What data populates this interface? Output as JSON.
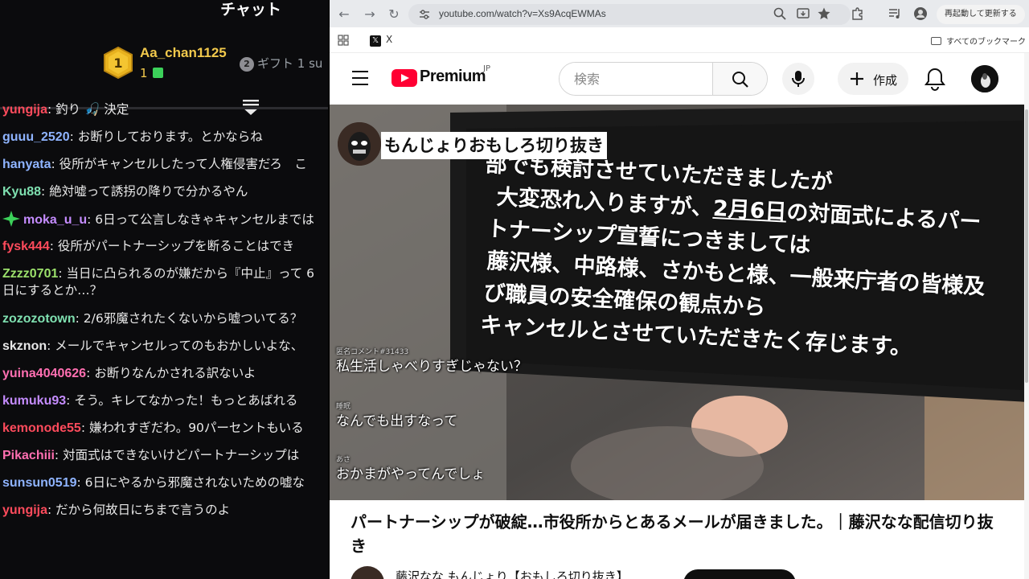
{
  "chat": {
    "title": "チャット",
    "leaderboard": {
      "rank1": "1",
      "top_name": "Aa_chan1125",
      "top_count": "1",
      "rank2": "2",
      "second_label": "ギフト 1 su"
    },
    "messages": [
      {
        "user": "yungija",
        "text": "釣り 🎣 決定",
        "color": "#ff4b5c"
      },
      {
        "user": "guuu_2520",
        "text": "お断りしております。とかならね",
        "color": "#8fb4ff"
      },
      {
        "user": "hanyata",
        "text": "役所がキャンセルしたって人権侵害だろ　こ",
        "color": "#8fb4ff"
      },
      {
        "user": "Kyu88",
        "text": "絶対嘘って誘拐の降りで分かるやん",
        "color": "#7fe0b0"
      },
      {
        "user": "moka_u_u",
        "text": "6日って公言しなきゃキャンセルまでは",
        "color": "#c58cff",
        "badge": "sparkle-icon"
      },
      {
        "user": "fysk444",
        "text": "役所がパートナーシップを断ることはでき",
        "color": "#ff4b5c"
      },
      {
        "user": "Zzzz0701",
        "text": "当日に凸られるのが嫌だから『中止』って 6日にするとか…？",
        "color": "#9be06b",
        "two_line": true
      },
      {
        "user": "zozozotown",
        "text": "2/6邪魔されたくないから嘘ついてる？",
        "color": "#7fe0b0"
      },
      {
        "user": "skznon",
        "text": "メールでキャンセルってのもおかしいよな、",
        "color": "#e8e8e8"
      },
      {
        "user": "yuina4040626",
        "text": "お断りなんかされる訳ないよ",
        "color": "#ff6fb1"
      },
      {
        "user": "kumuku93",
        "text": "そう。キレてなかった！もっとあばれる",
        "color": "#c58cff"
      },
      {
        "user": "kemonode55",
        "text": "嫌われすぎだわ。90パーセントもいる",
        "color": "#ff4b5c"
      },
      {
        "user": "Pikachiii",
        "text": "対面式はできないけどパートナーシップは",
        "color": "#ff6fb1"
      },
      {
        "user": "sunsun0519",
        "text": "6日にやるから邪魔されないための嘘な",
        "color": "#8fb4ff"
      },
      {
        "user": "yungija",
        "text": "だから何故日にちまで言うのよ",
        "color": "#ff4b5c"
      }
    ]
  },
  "browser": {
    "url": "youtube.com/watch?v=Xs9AcqEWMAs",
    "relaunch_label": "再起動して更新する",
    "bookmarks": {
      "x_label": "X",
      "all_label": "すべてのブックマーク"
    }
  },
  "youtube": {
    "brand": "Premium",
    "region": "JP",
    "search_placeholder": "検索",
    "create_label": "作成",
    "video": {
      "phone_lines": [
        "部でも検討させていただきましたが",
        "大変恐れ入りますが、2月6日の対面式によるパー",
        "トナーシップ宣誓につきましては",
        "藤沢様、中路様、さかもと様、一般来庁者の皆様及",
        "び職員の安全確保の観点から",
        "キャンセルとさせていただきたく存じます。"
      ],
      "underline_text": "2月6日",
      "channel_badge": "もんじょりおもしろ切り抜き",
      "anon_comments": [
        {
          "tag": "匿名コメント#31433",
          "text": "私生活しゃべりすぎじゃない？"
        },
        {
          "tag": "睡眠",
          "text": "なんでも出すなって"
        },
        {
          "tag": "あさ",
          "text": "おかまがやってんでしょ"
        }
      ]
    },
    "title": "パートナーシップが破綻…市役所からとあるメールが届きました。｜藤沢なな配信切り抜き",
    "owner": "藤沢なな もんじょり【おもしろ切り抜き】"
  }
}
